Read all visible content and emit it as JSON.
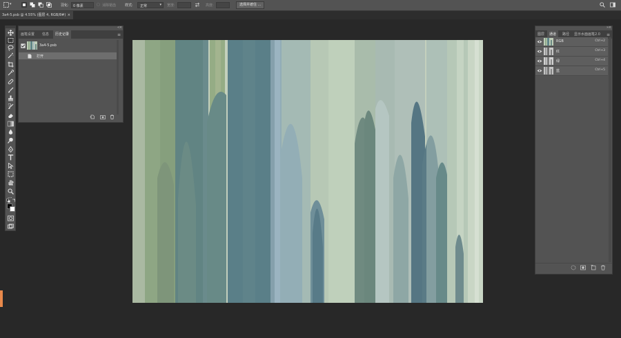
{
  "options_bar": {
    "feather_label": "羽化:",
    "feather_value": "0 像素",
    "antialias_label": "消除锯齿",
    "style_label": "样式:",
    "style_value": "正常",
    "width_label": "宽度:",
    "height_label": "高度:",
    "select_mask_button": "选择并遮住 ..."
  },
  "document_tab": {
    "title": "3a4-5.psb @ 4.55% (图层 4, RGB/8#)",
    "close": "×"
  },
  "history_panel": {
    "tabs": [
      "画笔设置",
      "信息",
      "历史记录"
    ],
    "active_tab": 2,
    "snapshot_name": "3a4-5.psb",
    "steps": [
      "打开"
    ]
  },
  "channels_panel": {
    "tabs": [
      "图层",
      "通道",
      "路径",
      "显示水面画笔2.0"
    ],
    "active_tab": 1,
    "channels": [
      {
        "name": "RGB",
        "shortcut": "Ctrl+2"
      },
      {
        "name": "红",
        "shortcut": "Ctrl+3"
      },
      {
        "name": "绿",
        "shortcut": "Ctrl+4"
      },
      {
        "name": "蓝",
        "shortcut": "Ctrl+5"
      }
    ]
  },
  "tools": [
    "move-tool",
    "marquee-tool",
    "lasso-tool",
    "magic-wand-tool",
    "crop-tool",
    "eyedropper-tool",
    "healing-brush-tool",
    "brush-tool",
    "clone-stamp-tool",
    "history-brush-tool",
    "eraser-tool",
    "gradient-tool",
    "blur-tool",
    "dodge-tool",
    "pen-tool",
    "type-tool",
    "path-selection-tool",
    "shape-tool",
    "hand-tool",
    "zoom-tool",
    "more-tools"
  ],
  "colors": {
    "ui_panel": "#535353",
    "workspace": "#282828",
    "canvas_base": "#c4d0bd",
    "accent_orange": "#e8894b"
  }
}
